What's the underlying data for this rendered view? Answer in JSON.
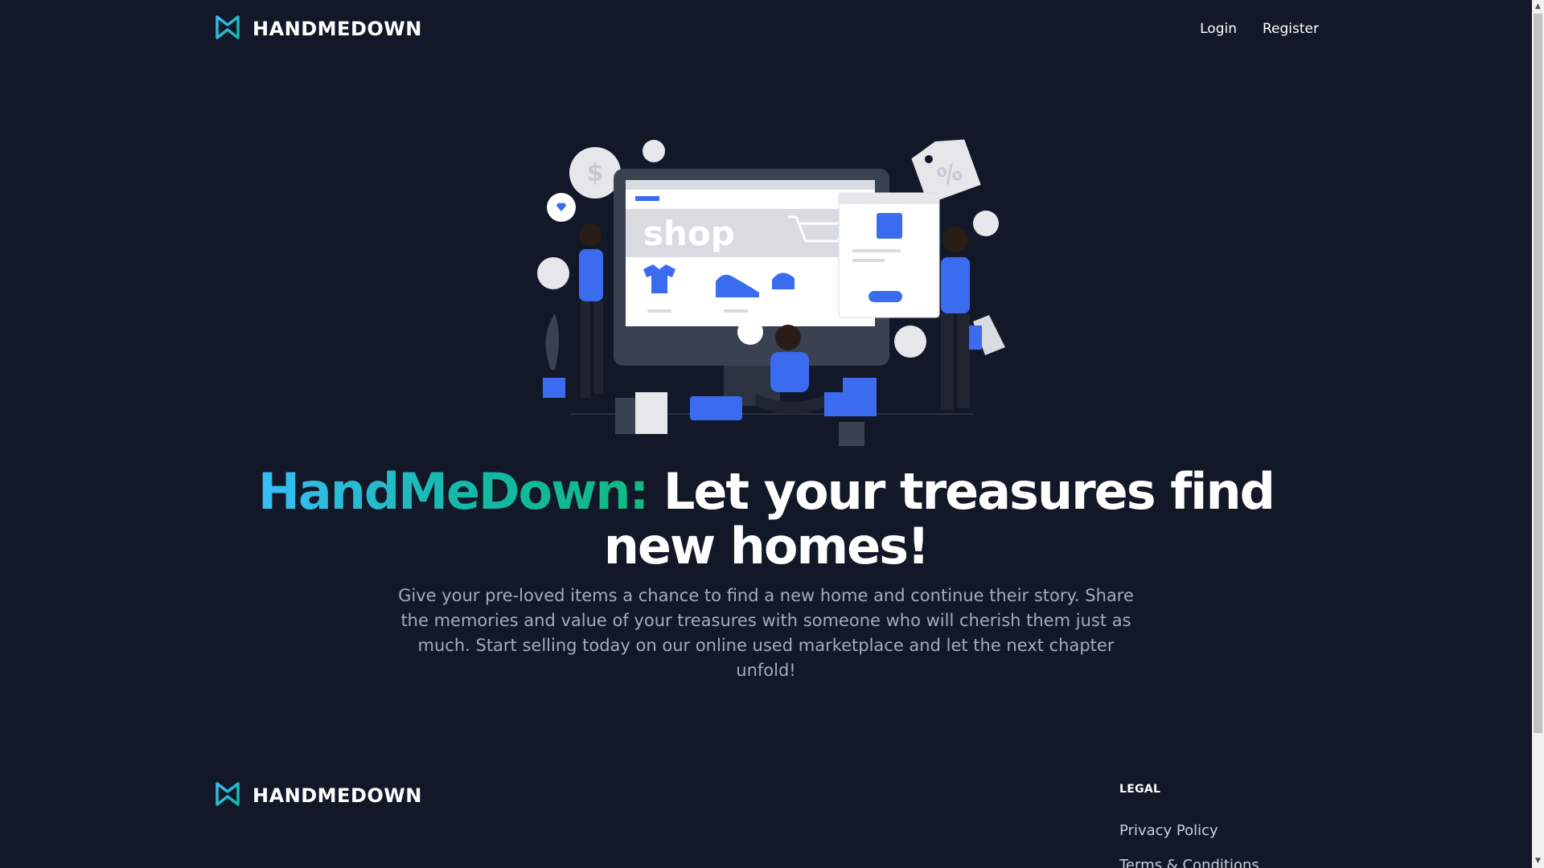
{
  "header": {
    "brand": "HANDMEDOWN",
    "nav": {
      "login": "Login",
      "register": "Register"
    }
  },
  "hero": {
    "illustration_text": "shop",
    "headline_accent": "HandMeDown:",
    "headline_rest": " Let your treasures find new homes!",
    "subtext": "Give your pre-loved items a chance to find a new home and continue their story. Share the memories and value of your treasures with someone who will cherish them just as much. Start selling today on our online used marketplace and let the next chapter unfold!"
  },
  "footer": {
    "brand": "HANDMEDOWN",
    "legal": {
      "title": "LEGAL",
      "links": [
        "Privacy Policy",
        "Terms & Conditions"
      ]
    }
  },
  "colors": {
    "background": "#121827",
    "accent_start": "#38bdf8",
    "accent_end": "#10b981",
    "illustration_blue": "#3b6cf0"
  },
  "icons": {
    "logo": "bowtie-logo-icon",
    "scroll_up": "triangle-up",
    "scroll_down": "triangle-down"
  }
}
